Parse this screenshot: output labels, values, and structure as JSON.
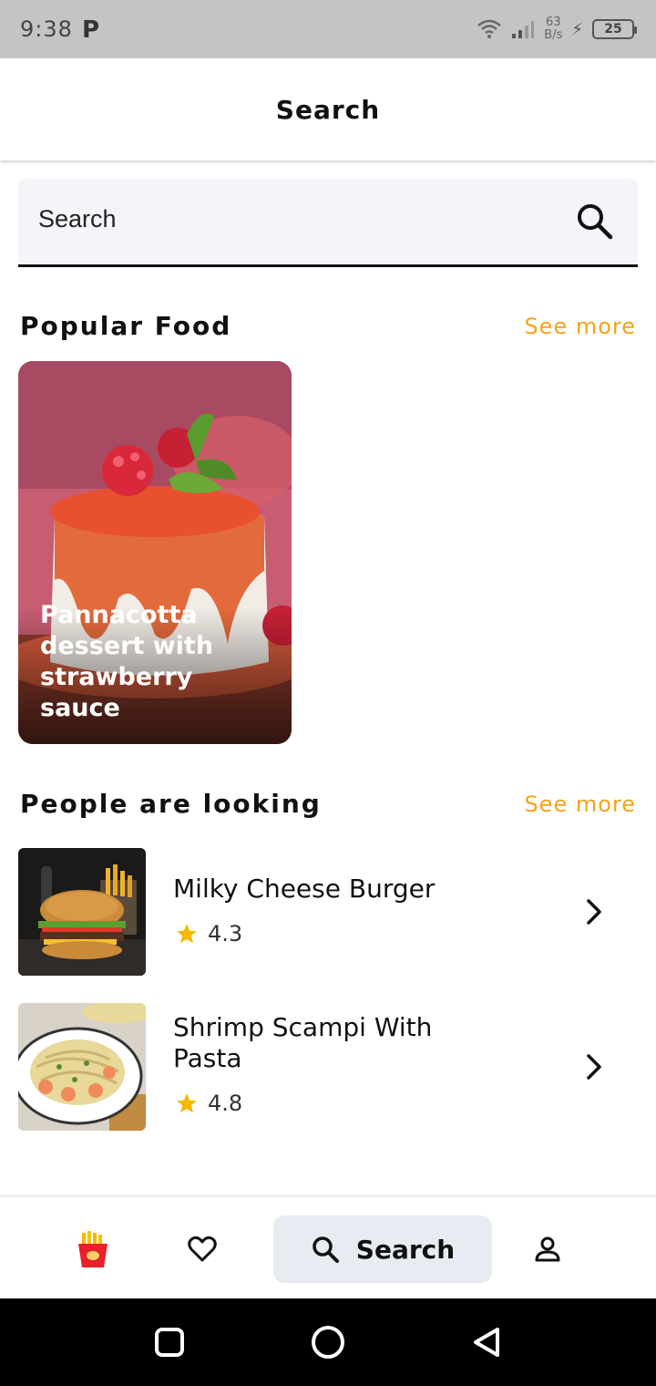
{
  "status_bar": {
    "time": "9:38",
    "carrier_icon": "P",
    "speed_value": "63",
    "speed_unit": "B/s",
    "battery": "25"
  },
  "header": {
    "title": "Search"
  },
  "search": {
    "placeholder": "Search"
  },
  "popular": {
    "title": "Popular Food",
    "see_more": "See more",
    "items": [
      {
        "name": "Pannacotta dessert with strawberry sauce"
      }
    ]
  },
  "looking": {
    "title": "People are looking",
    "see_more": "See more",
    "items": [
      {
        "name": "Milky Cheese Burger",
        "rating": "4.3"
      },
      {
        "name": "Shrimp Scampi With Pasta",
        "rating": "4.8"
      }
    ]
  },
  "bottom_nav": {
    "active_label": "Search"
  },
  "colors": {
    "accent": "#f5a31a",
    "star": "#f5b800",
    "nav_active_bg": "#e8ecf2"
  },
  "icons": [
    "wifi-icon",
    "signal-icon",
    "battery-icon",
    "search-icon",
    "chevron-right-icon",
    "star-icon",
    "fries-icon",
    "heart-icon",
    "user-icon",
    "square-icon",
    "circle-icon",
    "back-triangle-icon"
  ]
}
